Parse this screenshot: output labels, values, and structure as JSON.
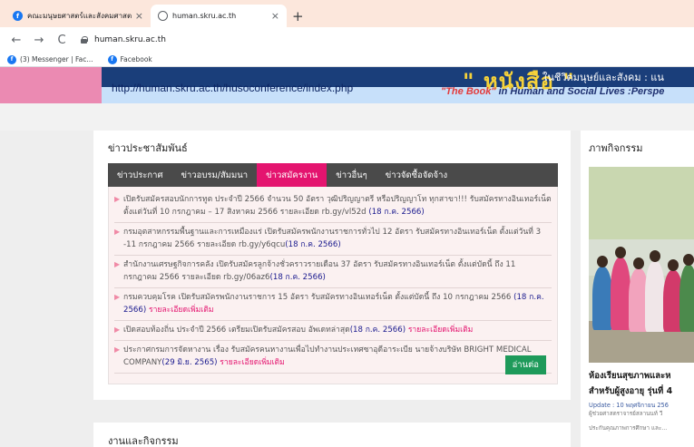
{
  "browser": {
    "tabs": [
      {
        "title": "คณะมนุษยศาสตร์และสังคมศาสตร์มห",
        "icon": "facebook-icon",
        "active": false
      },
      {
        "title": "human.skru.ac.th",
        "icon": "globe-icon",
        "active": true
      }
    ],
    "new_tab": "+",
    "close_tab": "×",
    "nav": {
      "back": "←",
      "forward": "→",
      "reload": "C"
    },
    "url": "human.skru.ac.th",
    "bookmarks": [
      {
        "label": "(3) Messenger | Fac...",
        "icon": "facebook-icon"
      },
      {
        "label": "Facebook",
        "icon": "facebook-icon"
      }
    ]
  },
  "banner": {
    "url": "http://human.skru.ac.th/husoconference/index.php",
    "big_word": "\" หนังสือ \"",
    "line1": "ในชีวิตมนุษย์และสังคม : แน",
    "line2_highlight": "\"The Book\"",
    "line2_rest": " in Human and Social Lives :Perspe"
  },
  "news": {
    "title": "ข่าวประชาสัมพันธ์",
    "tabs": [
      {
        "label": "ข่าวประกาศ",
        "active": false
      },
      {
        "label": "ข่าวอบรม/สัมมนา",
        "active": false
      },
      {
        "label": "ข่าวสมัครงาน",
        "active": true
      },
      {
        "label": "ข่าวอื่นๆ",
        "active": false
      },
      {
        "label": "ข่าวจัดซื้อจัดจ้าง",
        "active": false
      }
    ],
    "items": [
      {
        "text": "เปิดรับสมัครสอบนักการทูต ประจำปี 2566 จำนวน 50 อัตรา วุฒิปริญญาตรี หรือปริญญาโท ทุกสาขา!!! รับสมัครทางอินเทอร์เน็ต ตั้งแต่วันที่ 10 กรกฎาคม – 17 สิงหาคม 2566 รายละเอียด rb.gy/vl52d",
        "date": "(18 ก.ค. 2566)",
        "more": ""
      },
      {
        "text": "กรมอุตสาหกรรมพื้นฐานและการเหมืองแร่ เปิดรับสมัครพนักงานราชการทั่วไป 12 อัตรา รับสมัครทางอินเทอร์เน็ต ตั้งแต่วันที่ 3 -11 กรกฎาคม 2566 รายละเอียด rb.gy/y6qcu",
        "date": "(18 ก.ค. 2566)",
        "more": ""
      },
      {
        "text": "สำนักงานเศรษฐกิจการคลัง เปิดรับสมัครลูกจ้างชั่วคราวรายเดือน 37 อัตรา รับสมัครทางอินเทอร์เน็ต ตั้งแต่บัดนี้ ถึง 11 กรกฎาคม 2566 รายละเอียด rb.gy/06az6",
        "date": "(18 ก.ค. 2566)",
        "more": ""
      },
      {
        "text": "กรมควบคุมโรค เปิดรับสมัครพนักงานราชการ 15 อัตรา รับสมัครทางอินเทอร์เน็ต ตั้งแต่บัดนี้ ถึง 10 กรกฎาคม 2566",
        "date": "(18 ก.ค. 2566)",
        "more": "รายละเอียดเพิ่มเติม"
      },
      {
        "text": "เปิดสอบท้องถิ่น ประจำปี 2566 เตรียมเปิดรับสมัครสอบ อัพเดทล่าสุด",
        "date": "(18 ก.ค. 2566)",
        "more": "รายละเอียดเพิ่มเติม"
      },
      {
        "text": "ประกาศกรมการจัดหางาน เรื่อง รับสมัครคนหางานเพื่อไปทำงานประเทศซาอุดีอาระเบีย นายจ้างบริษัท BRIGHT MEDICAL COMPANY",
        "date": "(29 มิ.ย. 2565)",
        "more": "รายละเอียดเพิ่มเติม"
      }
    ],
    "read_more": "อ่านต่อ"
  },
  "activities_section": {
    "title": "งานและกิจกรรม"
  },
  "photo_section": {
    "title": "ภาพกิจกรรม",
    "caption_line1": "ห้องเรียนสุขภาพและห",
    "caption_line2": "สำหรับผู้สูงอายุ รุ่นที่ 4",
    "update": "Update : 10 พฤศจิกายน 256",
    "author": "ผู้ช่วยศาสตราจารย์สลานนท์ วี",
    "tag": "ประกันคุณภาพการศึกษา และ..."
  }
}
